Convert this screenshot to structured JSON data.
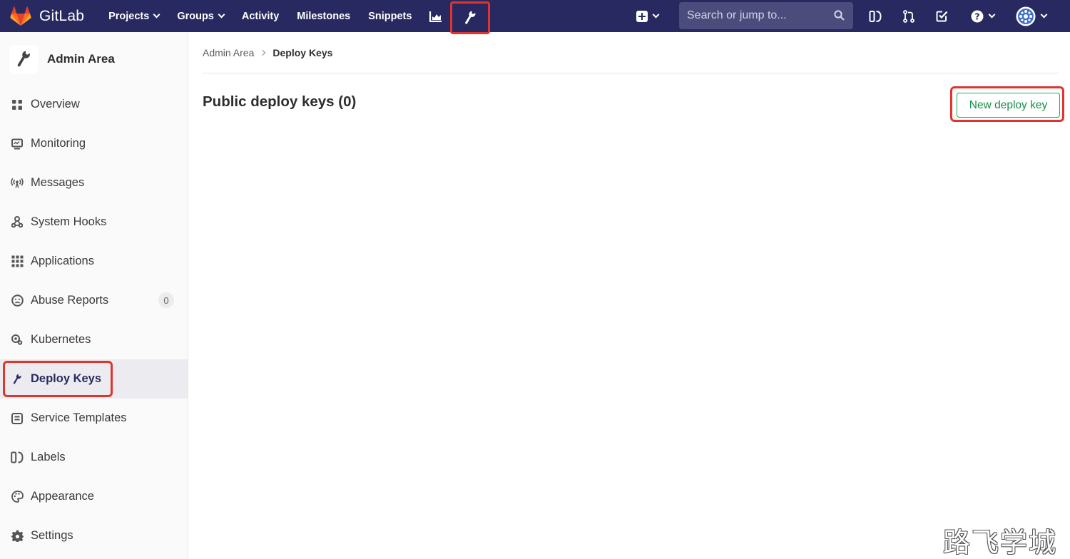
{
  "colors": {
    "navbar": "#292961",
    "highlight": "#e0342f",
    "success": "#1aaa55",
    "active_text": "#292961"
  },
  "navbar": {
    "brand": "GitLab",
    "links": [
      {
        "label": "Projects",
        "icon": "chevron-down-icon"
      },
      {
        "label": "Groups",
        "icon": "chevron-down-icon"
      },
      {
        "label": "Activity"
      },
      {
        "label": "Milestones"
      },
      {
        "label": "Snippets"
      }
    ],
    "icons": [
      "chart-icon",
      "wrench-icon",
      "plus-square-icon",
      "issues-icon",
      "merge-request-icon",
      "todo-icon",
      "help-icon",
      "avatar-icon"
    ],
    "search": {
      "placeholder": "Search or jump to..."
    }
  },
  "sidebar": {
    "title": "Admin Area",
    "items": [
      {
        "label": "Overview",
        "icon": "grid-icon"
      },
      {
        "label": "Monitoring",
        "icon": "monitor-icon"
      },
      {
        "label": "Messages",
        "icon": "broadcast-icon"
      },
      {
        "label": "System Hooks",
        "icon": "hook-icon"
      },
      {
        "label": "Applications",
        "icon": "apps-icon"
      },
      {
        "label": "Abuse Reports",
        "icon": "sad-face-icon",
        "badge": "0"
      },
      {
        "label": "Kubernetes",
        "icon": "kubernetes-icon"
      },
      {
        "label": "Deploy Keys",
        "icon": "key-icon",
        "active": true
      },
      {
        "label": "Service Templates",
        "icon": "template-icon"
      },
      {
        "label": "Labels",
        "icon": "labels-icon"
      },
      {
        "label": "Appearance",
        "icon": "palette-icon"
      },
      {
        "label": "Settings",
        "icon": "gear-icon"
      }
    ]
  },
  "breadcrumb": {
    "parent": "Admin Area",
    "current": "Deploy Keys"
  },
  "main": {
    "title": "Public deploy keys (0)",
    "new_button": "New deploy key"
  },
  "watermark": "路飞学城"
}
